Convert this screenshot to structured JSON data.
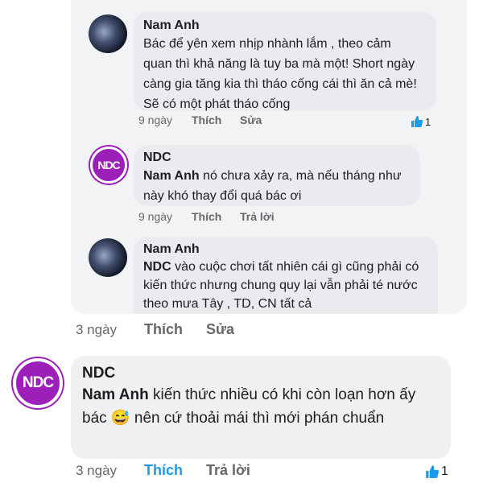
{
  "thread": {
    "comments": [
      {
        "author": "Nam Anh",
        "text": "Bác để yên xem nhịp nhành lắm , theo cảm quan thì khả năng là tuy ba mà một! Short ngày càng gia tăng kia thì tháo cống cái thì ăn cả mè! Sẽ có một phát tháo cống",
        "time": "9 ngày",
        "like": "Thích",
        "action": "Sửa",
        "reaction_count": "1"
      },
      {
        "author": "NDC",
        "avatar_text": "NDC",
        "mention": "Nam Anh",
        "text": "nó chưa xảy ra, mà nếu tháng như này khó thay đổi quá bác ơi",
        "time": "9 ngày",
        "like": "Thích",
        "action": "Trả lời"
      },
      {
        "author": "Nam Anh",
        "mention": "NDC",
        "text": "vào cuộc chơi tất nhiên cái gì cũng phải có kiến thức nhưng chung quy lại vẫn phải té nước theo mưa Tây , TD, CN tất cả",
        "time": "3 ngày",
        "like": "Thích",
        "action": "Sửa"
      }
    ]
  },
  "main_comment": {
    "author": "NDC",
    "avatar_text": "NDC",
    "mention": "Nam Anh",
    "text_before_emoji": "kiến thức nhiều có khi còn loạn hơn ấy bác",
    "text_after_emoji": "nên cứ thoải mái thì mới phán chuẩn",
    "emoji": "😅",
    "time": "3 ngày",
    "like": "Thích",
    "action": "Trả lời",
    "reaction_count": "1"
  },
  "colors": {
    "like_active": "#1a9be6",
    "ndc_purple": "#9b1fb8",
    "meta_grey": "#65676b"
  }
}
